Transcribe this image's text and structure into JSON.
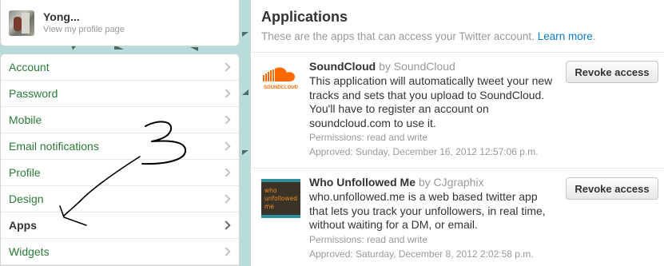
{
  "profile": {
    "name": "Yong...",
    "link_label": "View my profile page"
  },
  "menu": {
    "items": [
      {
        "label": "Account",
        "active": false
      },
      {
        "label": "Password",
        "active": false
      },
      {
        "label": "Mobile",
        "active": false
      },
      {
        "label": "Email notifications",
        "active": false
      },
      {
        "label": "Profile",
        "active": false
      },
      {
        "label": "Design",
        "active": false
      },
      {
        "label": "Apps",
        "active": true
      },
      {
        "label": "Widgets",
        "active": false
      }
    ]
  },
  "applications": {
    "title": "Applications",
    "subtitle": "These are the apps that can access your Twitter account.",
    "learn_more": "Learn more",
    "subtitle_end": ".",
    "apps": [
      {
        "name": "SoundCloud",
        "by": "by SoundCloud",
        "icon_name": "soundcloud-icon",
        "icon_text": "SOUNDCLOUD",
        "description": "This application will automatically tweet your new tracks and sets that you upload to SoundCloud. You'll have to register an account on soundcloud.com to use it.",
        "permissions": "Permissions: read and write",
        "approved": "Approved: Sunday, December 16, 2012 12:57:06 p.m.",
        "button": "Revoke access"
      },
      {
        "name": "Who Unfollowed Me",
        "by": "by CJgraphix",
        "icon_name": "who-unfollowed-me-icon",
        "icon_text_1": "who",
        "icon_text_2": "unfollowed",
        "icon_text_3": "me",
        "description": "who.unfollowed.me is a web based twitter app that lets you track your unfollowers, in real time, without waiting for a DM, or email.",
        "permissions": "Permissions: read and write",
        "approved": "Approved: Saturday, December 8, 2012 2:02:58 p.m.",
        "button": "Revoke access"
      }
    ]
  },
  "annotation": {
    "handwritten_text": "3",
    "color": "#000000"
  },
  "colors": {
    "link_green": "#2a7b35",
    "link_blue": "#0a7bc4",
    "background": "#b7dcd9",
    "soundcloud_orange": "#ff6a00"
  }
}
